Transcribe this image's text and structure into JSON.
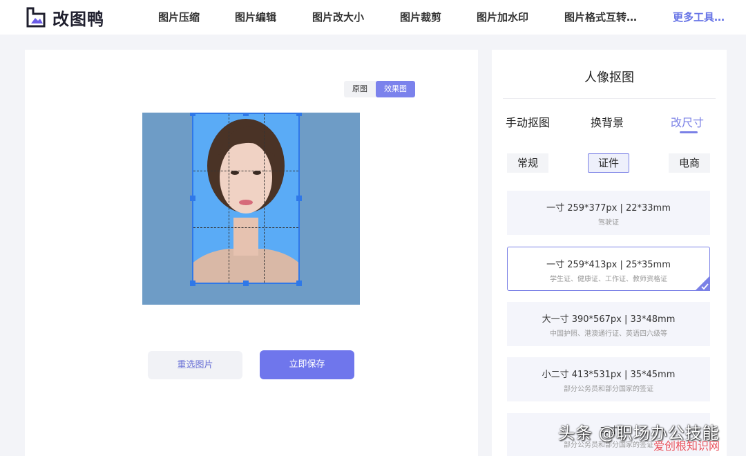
{
  "header": {
    "logo_text": "改图鸭",
    "nav": [
      {
        "label": "图片压缩"
      },
      {
        "label": "图片编辑"
      },
      {
        "label": "图片改大小"
      },
      {
        "label": "图片裁剪"
      },
      {
        "label": "图片加水印"
      },
      {
        "label": "图片格式互转…"
      },
      {
        "label": "更多工具…"
      }
    ]
  },
  "editor": {
    "toggle": {
      "original": "原图",
      "effect": "效果图"
    },
    "reselect_label": "重选图片",
    "save_label": "立即保存"
  },
  "sidebar": {
    "title": "人像抠图",
    "tabs": [
      {
        "label": "手动抠图"
      },
      {
        "label": "换背景"
      },
      {
        "label": "改尺寸"
      }
    ],
    "active_tab": "改尺寸",
    "subtabs": [
      {
        "label": "常规"
      },
      {
        "label": "证件"
      },
      {
        "label": "电商"
      }
    ],
    "active_subtab": "证件",
    "sizes": [
      {
        "main": "一寸 259*377px | 22*33mm",
        "sub": "驾驶证"
      },
      {
        "main": "一寸 259*413px | 25*35mm",
        "sub": "学生证、健康证、工作证、教师资格证",
        "selected": true
      },
      {
        "main": "大一寸 390*567px | 33*48mm",
        "sub": "中国护照、港澳通行证、英语四六级等"
      },
      {
        "main": "小二寸 413*531px | 35*45mm",
        "sub": "部分公务员和部分国家的签证"
      },
      {
        "main": "二寸 ",
        "sub": "部分公务员和部分国家的签证"
      }
    ]
  },
  "watermark": {
    "main": "头条 @职场办公技能",
    "sub": "爱创根知识网"
  },
  "colors": {
    "accent": "#7a80e6",
    "save_button": "#6f76ec",
    "crop_bg": "#5aabf6",
    "photo_bg": "#6e9cc6",
    "crop_border": "#2f78e8"
  }
}
